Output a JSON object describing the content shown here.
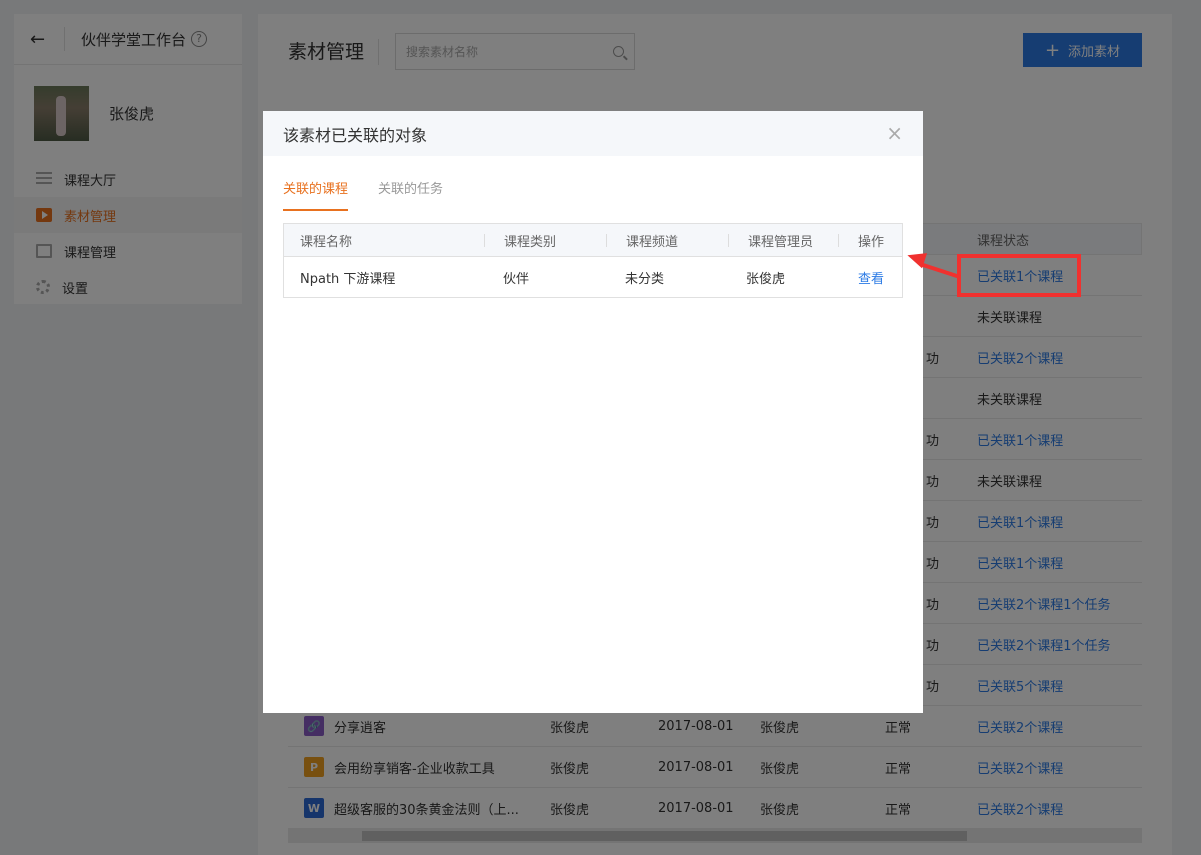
{
  "sidebar": {
    "title": "伙伴学堂工作台",
    "help": "?",
    "user_name": "张俊虎",
    "items": [
      {
        "label": "课程大厅"
      },
      {
        "label": "素材管理"
      },
      {
        "label": "课程管理"
      },
      {
        "label": "设置"
      }
    ]
  },
  "main": {
    "title": "素材管理",
    "search_placeholder": "搜索素材名称",
    "add_button": "添加素材",
    "header_status": "课程状态",
    "status_col": [
      {
        "status": "已关联1个课程",
        "type": "link",
        "extra": ""
      },
      {
        "status": "未关联课程",
        "type": "plain",
        "extra": ""
      },
      {
        "status": "已关联2个课程",
        "type": "link",
        "extra": "功"
      },
      {
        "status": "未关联课程",
        "type": "plain",
        "extra": ""
      },
      {
        "status": "已关联1个课程",
        "type": "link",
        "extra": "功"
      },
      {
        "status": "未关联课程",
        "type": "plain",
        "extra": "功"
      },
      {
        "status": "已关联1个课程",
        "type": "link",
        "extra": "功"
      },
      {
        "status": "已关联1个课程",
        "type": "link",
        "extra": "功"
      },
      {
        "status": "已关联2个课程1个任务",
        "type": "link",
        "extra": "功"
      },
      {
        "status": "已关联2个课程1个任务",
        "type": "link",
        "extra": "功"
      },
      {
        "status": "已关联5个课程",
        "type": "link",
        "extra": "功"
      }
    ],
    "full_rows": [
      {
        "icon": "🔗",
        "icon_color": "#8b5cc7",
        "name": "分享逍客",
        "creator": "张俊虎",
        "date": "2017-08-01",
        "admin": "张俊虎",
        "state": "正常",
        "status": "已关联2个课程"
      },
      {
        "icon": "P",
        "icon_color": "#f0a020",
        "name": "会用纷享销客-企业收款工具",
        "creator": "张俊虎",
        "date": "2017-08-01",
        "admin": "张俊虎",
        "state": "正常",
        "status": "已关联2个课程"
      },
      {
        "icon": "W",
        "icon_color": "#2c6bd6",
        "name": "超级客服的30条黄金法则（上...",
        "creator": "张俊虎",
        "date": "2017-08-01",
        "admin": "张俊虎",
        "state": "正常",
        "status": "已关联2个课程"
      }
    ]
  },
  "modal": {
    "title": "该素材已关联的对象",
    "close": "×",
    "tabs": [
      "关联的课程",
      "关联的任务"
    ],
    "columns": [
      "课程名称",
      "课程类别",
      "课程频道",
      "课程管理员",
      "操作"
    ],
    "rows": [
      {
        "name": "Npath 下游课程",
        "category": "伙伴",
        "channel": "未分类",
        "admin": "张俊虎",
        "action": "查看"
      }
    ]
  }
}
